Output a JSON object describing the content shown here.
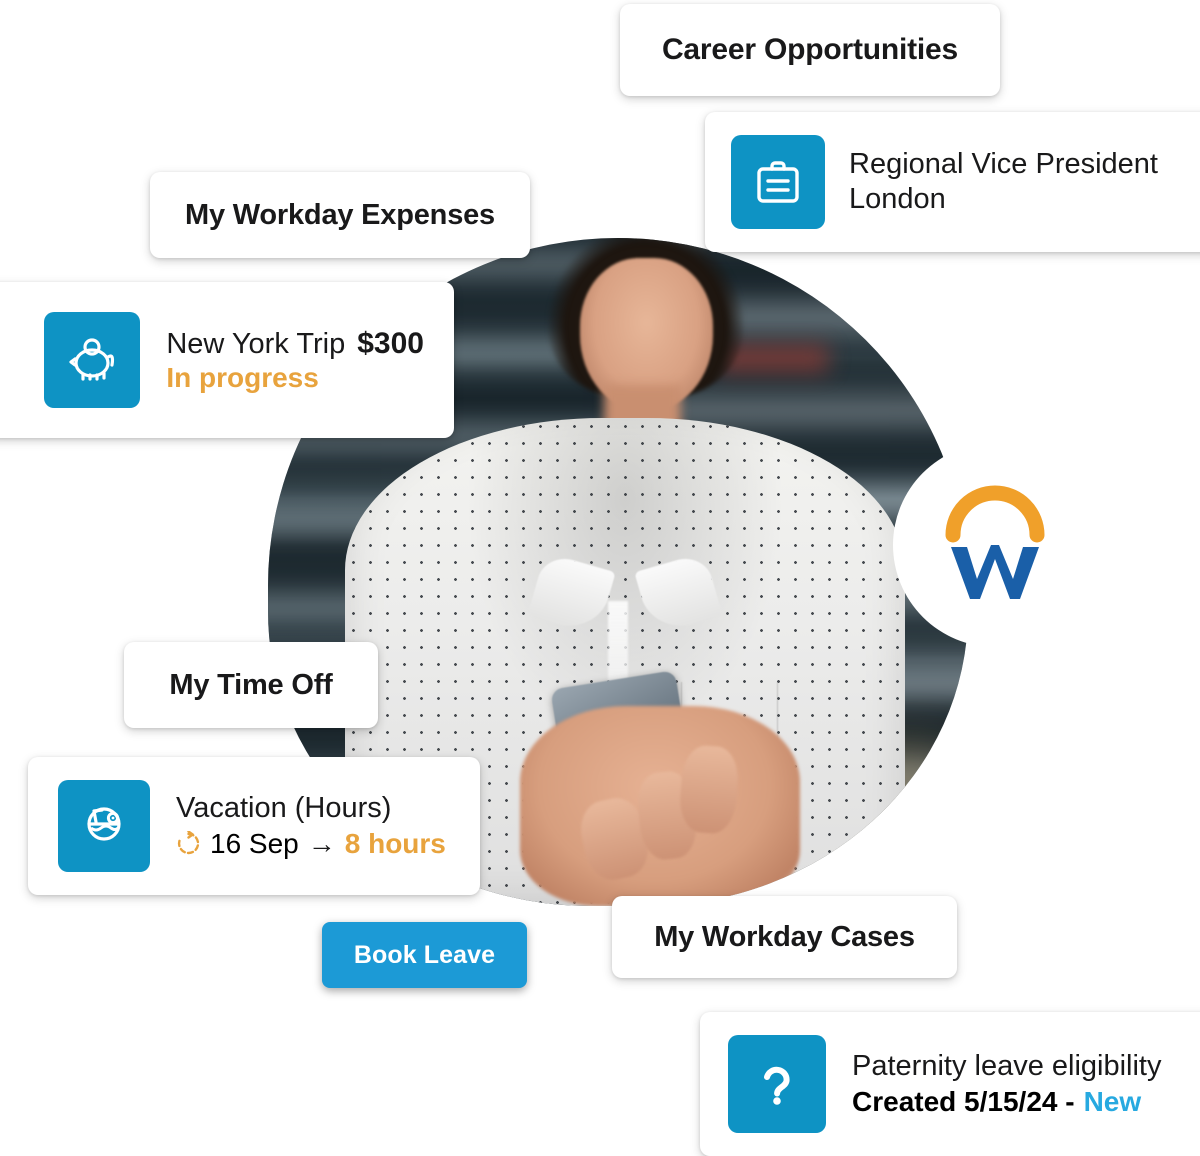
{
  "brand": {
    "name": "Workday",
    "logo_icon": "workday-logo",
    "accent_blue": "#0e93c4",
    "tile_blue": "#0e93c4",
    "button_blue": "#1c9ad6",
    "accent_orange": "#e8a33d",
    "logo_orange": "#f0a02a",
    "logo_blue": "#1a5fa8",
    "new_blue": "#27a9e0",
    "text_dark": "#19191a"
  },
  "cards": {
    "career": {
      "title": "Career Opportunities"
    },
    "career_item": {
      "icon": "briefcase-icon",
      "line1": "Regional Vice President",
      "line2": "London"
    },
    "expenses": {
      "title": "My Workday Expenses"
    },
    "expense_item": {
      "icon": "piggy-bank-icon",
      "name": "New York Trip",
      "amount": "$300",
      "status": "In progress"
    },
    "timeoff": {
      "title": "My Time Off"
    },
    "timeoff_item": {
      "icon": "coconut-drink-icon",
      "name": "Vacation (Hours)",
      "recurring_icon": "refresh-icon",
      "date": "16 Sep",
      "arrow": "→",
      "hours": "8 hours"
    },
    "timeoff_action": {
      "label": "Book Leave"
    },
    "cases": {
      "title": "My Workday Cases"
    },
    "case_item": {
      "icon": "question-mark-icon",
      "subject": "Paternity leave eligibility",
      "created_label": "Created 5/15/24 -",
      "status": "New"
    }
  },
  "photo": {
    "alt": "Smiling woman in white polka-dot shirt using a smartphone in a warehouse"
  }
}
